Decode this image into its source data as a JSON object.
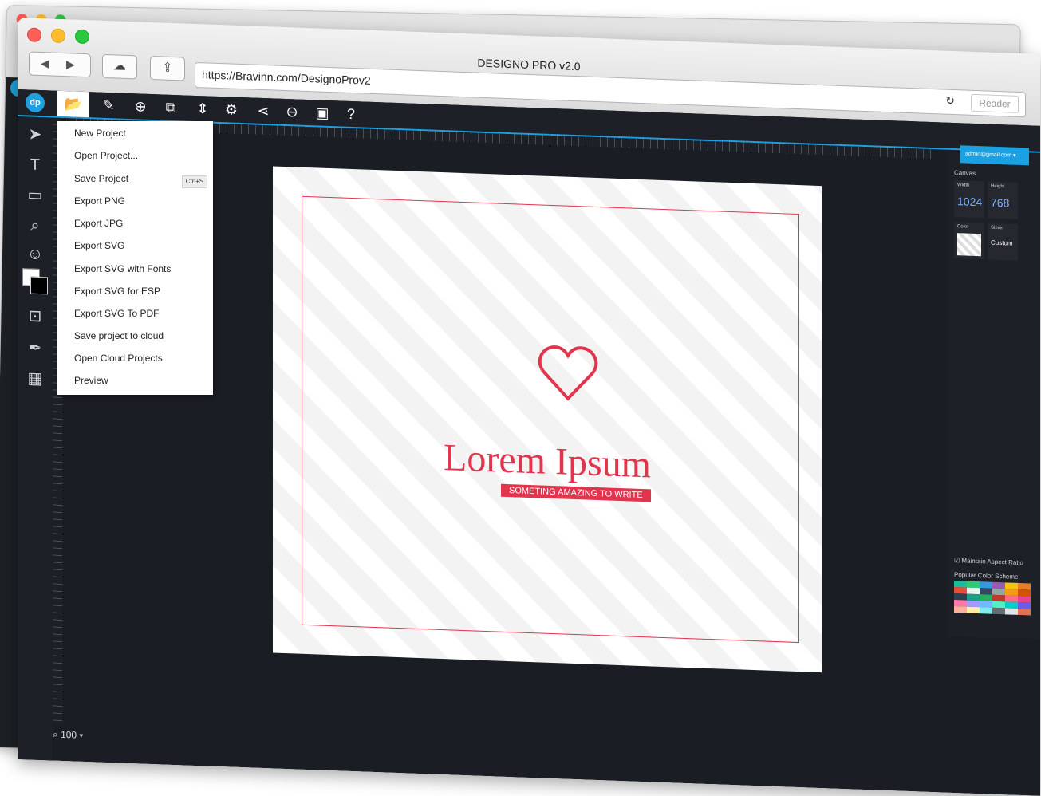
{
  "browser": {
    "window_title": "DESIGNO PRO v2.0",
    "url": "https://Bravinn.com/DesignoProv2",
    "reader_label": "Reader",
    "back_glyph": "◀",
    "forward_glyph": "▶"
  },
  "toolbar": {
    "icons": [
      "folder-open-icon",
      "pencil-icon",
      "add-circle-icon",
      "resize-icon",
      "arrange-icon",
      "settings-icon",
      "share-icon",
      "back-arrow-icon",
      "image-icon",
      "help-icon"
    ]
  },
  "file_menu": {
    "items": [
      {
        "label": "New Project"
      },
      {
        "label": "Open Project..."
      },
      {
        "label": "Save Project",
        "shortcut": "Ctrl+S"
      },
      {
        "label": "Export PNG"
      },
      {
        "label": "Export JPG"
      },
      {
        "label": "Export SVG"
      },
      {
        "label": "Export SVG with Fonts"
      },
      {
        "label": "Export SVG for ESP"
      },
      {
        "label": "Export SVG To PDF"
      },
      {
        "label": "Save project to cloud"
      },
      {
        "label": "Open Cloud Projects"
      },
      {
        "label": "Preview"
      }
    ]
  },
  "canvas_content": {
    "headline": "Lorem Ipsum",
    "tagline": "SOMETING AMAZING TO WRITE",
    "accent_color": "#e3344e"
  },
  "right_panel": {
    "user": "admin@gmail.com",
    "section": "Canvas",
    "width_label": "Width",
    "width_value": "1024",
    "height_label": "Height",
    "height_value": "768",
    "color_label": "Color",
    "sizes_label": "Sizes",
    "sizes_value": "Custom",
    "aspect_label": "Maintain Aspect Ratio",
    "scheme_label": "Popular Color Scheme",
    "swatches": [
      "#1abc9c",
      "#2ecc71",
      "#3498db",
      "#9b59b6",
      "#f1c40f",
      "#e67e22",
      "#e74c3c",
      "#ecf0f1",
      "#34495e",
      "#95a5a6",
      "#f39c12",
      "#d35400",
      "#2c3e50",
      "#16a085",
      "#27ae60",
      "#c0392b",
      "#ff6b81",
      "#e84393",
      "#fd79a8",
      "#a29bfe",
      "#74b9ff",
      "#55efc4",
      "#00cec9",
      "#6c5ce7",
      "#fab1a0",
      "#ffeaa7",
      "#81ecec",
      "#636e72",
      "#dfe6e9",
      "#e17055"
    ]
  },
  "status": {
    "zoom": "100"
  }
}
